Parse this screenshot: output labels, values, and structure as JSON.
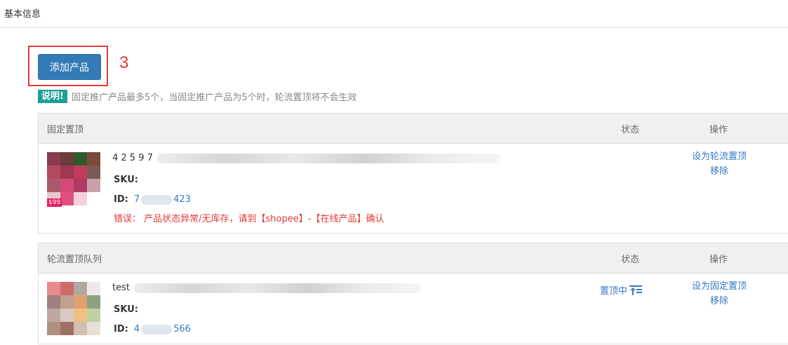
{
  "header": {
    "title": "基本信息"
  },
  "toolbar": {
    "add_button": "添加产品",
    "annotation": "3"
  },
  "notice": {
    "badge": "说明!",
    "text": "固定推广产品最多5个，当固定推广产品为5个时，轮流置顶将不会生效"
  },
  "fixed_panel": {
    "title": "固定置顶",
    "col_status": "状态",
    "col_action": "操作",
    "product": {
      "name_prefix": "4 2 5 9 7",
      "sku_label": "SKU:",
      "id_label": "ID:",
      "id_prefix": "7",
      "id_suffix": "423",
      "thumb_tag": "$99",
      "error_label": "错误：",
      "error_text": "产品状态异常/无库存，请到【shopee】-【在线产品】确认",
      "action_primary": "设为轮流置顶",
      "action_secondary": "移除"
    }
  },
  "rotation_panel": {
    "title": "轮流置顶队列",
    "col_status": "状态",
    "col_action": "操作",
    "product": {
      "name_prefix": "test",
      "sku_label": "SKU:",
      "id_label": "ID:",
      "id_prefix": "4",
      "id_suffix": "566",
      "status": "置顶中",
      "status_icon": "pin-top-icon",
      "action_primary": "设为固定置顶",
      "action_secondary": "移除"
    }
  },
  "colors": {
    "accent": "#337ab7",
    "link": "#3379c2",
    "error": "#e53935",
    "badge": "#1aa093"
  }
}
